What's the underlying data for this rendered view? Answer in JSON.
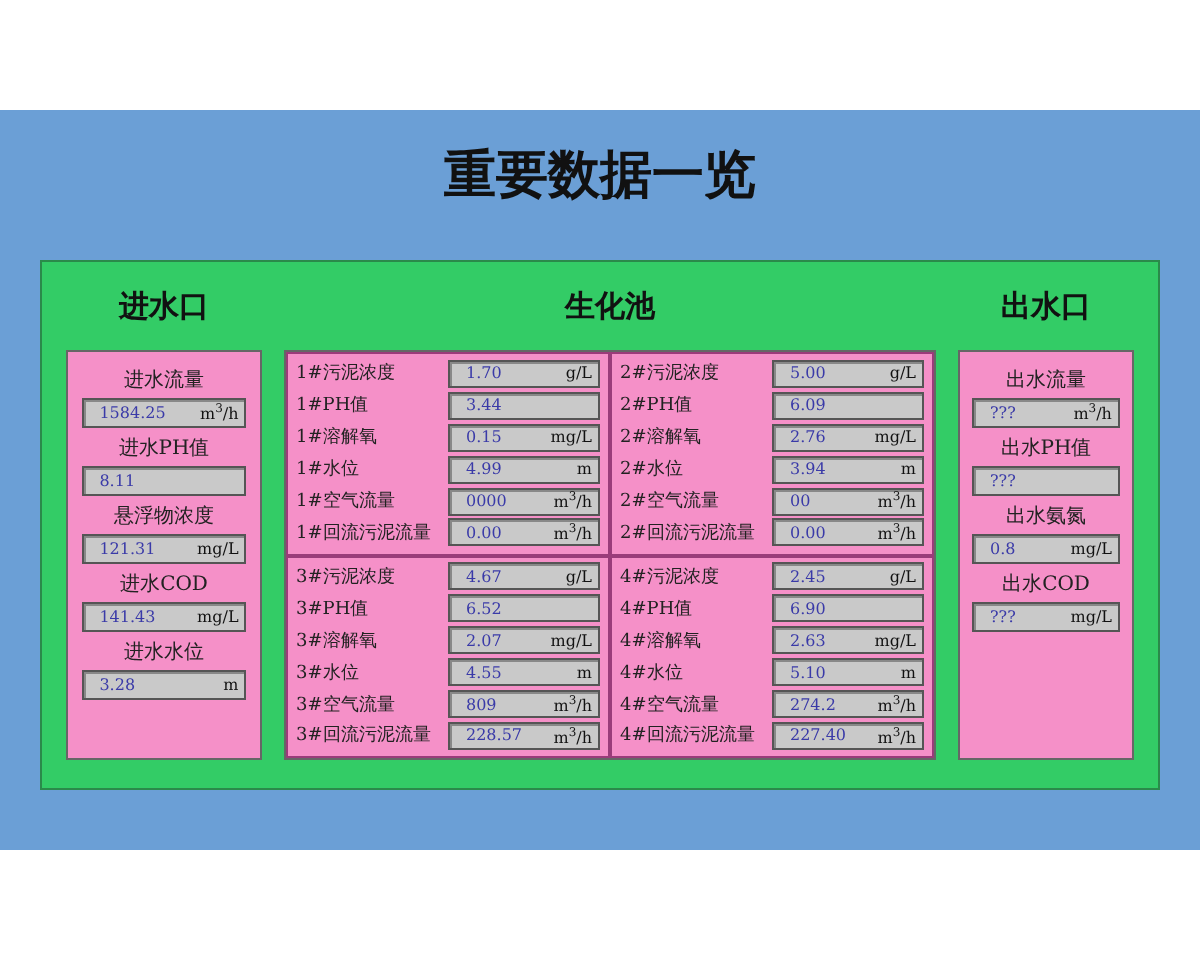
{
  "title": "重要数据一览",
  "inlet": {
    "heading": "进水口",
    "items": [
      {
        "label": "进水流量",
        "value": "1584.25",
        "unit": "m$^{3}$/h"
      },
      {
        "label": "进水PH值",
        "value": "8.11"
      },
      {
        "label": "悬浮物浓度",
        "value": "121.31",
        "unit": "mg/L"
      },
      {
        "label": "进水COD",
        "value": "141.43",
        "unit": "mg/L"
      },
      {
        "label": "进水水位",
        "value": "3.28",
        "unit": "m"
      }
    ]
  },
  "tank": {
    "heading": "生化池",
    "groups": [
      {
        "rows": [
          {
            "label": "1#污泥浓度",
            "value": "1.70",
            "unit": "g/L"
          },
          {
            "label": "1#PH值",
            "value": "3.44"
          },
          {
            "label": "1#溶解氧",
            "value": "0.15",
            "unit": "mg/L"
          },
          {
            "label": "1#水位",
            "value": "4.99",
            "unit": "m"
          },
          {
            "label": "1#空气流量",
            "value": "0000",
            "unit": "m$^{3}$/h"
          },
          {
            "label": "1#回流污泥流量",
            "value": "0.00",
            "unit": "m$^{3}$/h"
          }
        ]
      },
      {
        "rows": [
          {
            "label": "2#污泥浓度",
            "value": "5.00",
            "unit": "g/L"
          },
          {
            "label": "2#PH值",
            "value": "6.09"
          },
          {
            "label": "2#溶解氧",
            "value": "2.76",
            "unit": "mg/L"
          },
          {
            "label": "2#水位",
            "value": "3.94",
            "unit": "m"
          },
          {
            "label": "2#空气流量",
            "value": "00",
            "unit": "m$^{3}$/h"
          },
          {
            "label": "2#回流污泥流量",
            "value": "0.00",
            "unit": "m$^{3}$/h"
          }
        ]
      },
      {
        "rows": [
          {
            "label": "3#污泥浓度",
            "value": "4.67",
            "unit": "g/L"
          },
          {
            "label": "3#PH值",
            "value": "6.52"
          },
          {
            "label": "3#溶解氧",
            "value": "2.07",
            "unit": "mg/L"
          },
          {
            "label": "3#水位",
            "value": "4.55",
            "unit": "m"
          },
          {
            "label": "3#空气流量",
            "value": "809",
            "unit": "m$^{3}$/h"
          },
          {
            "label": "3#回流污泥流量",
            "value": "228.57",
            "unit": "m$^{3}$/h"
          }
        ]
      },
      {
        "rows": [
          {
            "label": "4#污泥浓度",
            "value": "2.45",
            "unit": "g/L"
          },
          {
            "label": "4#PH值",
            "value": "6.90"
          },
          {
            "label": "4#溶解氧",
            "value": "2.63",
            "unit": "mg/L"
          },
          {
            "label": "4#水位",
            "value": "5.10",
            "unit": "m"
          },
          {
            "label": "4#空气流量",
            "value": "274.2",
            "unit": "m$^{3}$/h"
          },
          {
            "label": "4#回流污泥流量",
            "value": "227.40",
            "unit": "m$^{3}$/h"
          }
        ]
      }
    ]
  },
  "outlet": {
    "heading": "出水口",
    "items": [
      {
        "label": "出水流量",
        "value": "???",
        "unit": "m$^{3}$/h"
      },
      {
        "label": "出水PH值",
        "value": "???"
      },
      {
        "label": "出水氨氮",
        "value": "0.8",
        "unit": "mg/L"
      },
      {
        "label": "出水COD",
        "value": "???",
        "unit": "mg/L"
      }
    ]
  }
}
